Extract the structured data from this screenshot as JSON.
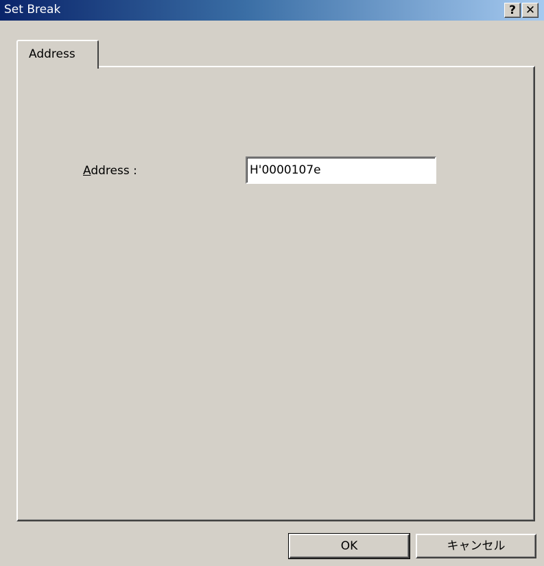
{
  "window": {
    "title": "Set Break",
    "help_glyph": "?",
    "close_glyph": "✕"
  },
  "tabs": [
    {
      "label": "Address",
      "active": true
    }
  ],
  "form": {
    "address_label_mnemonic": "A",
    "address_label_rest": "ddress :",
    "address_value": "H'0000107e"
  },
  "buttons": {
    "ok_label": "OK",
    "cancel_label": "キャンセル"
  }
}
